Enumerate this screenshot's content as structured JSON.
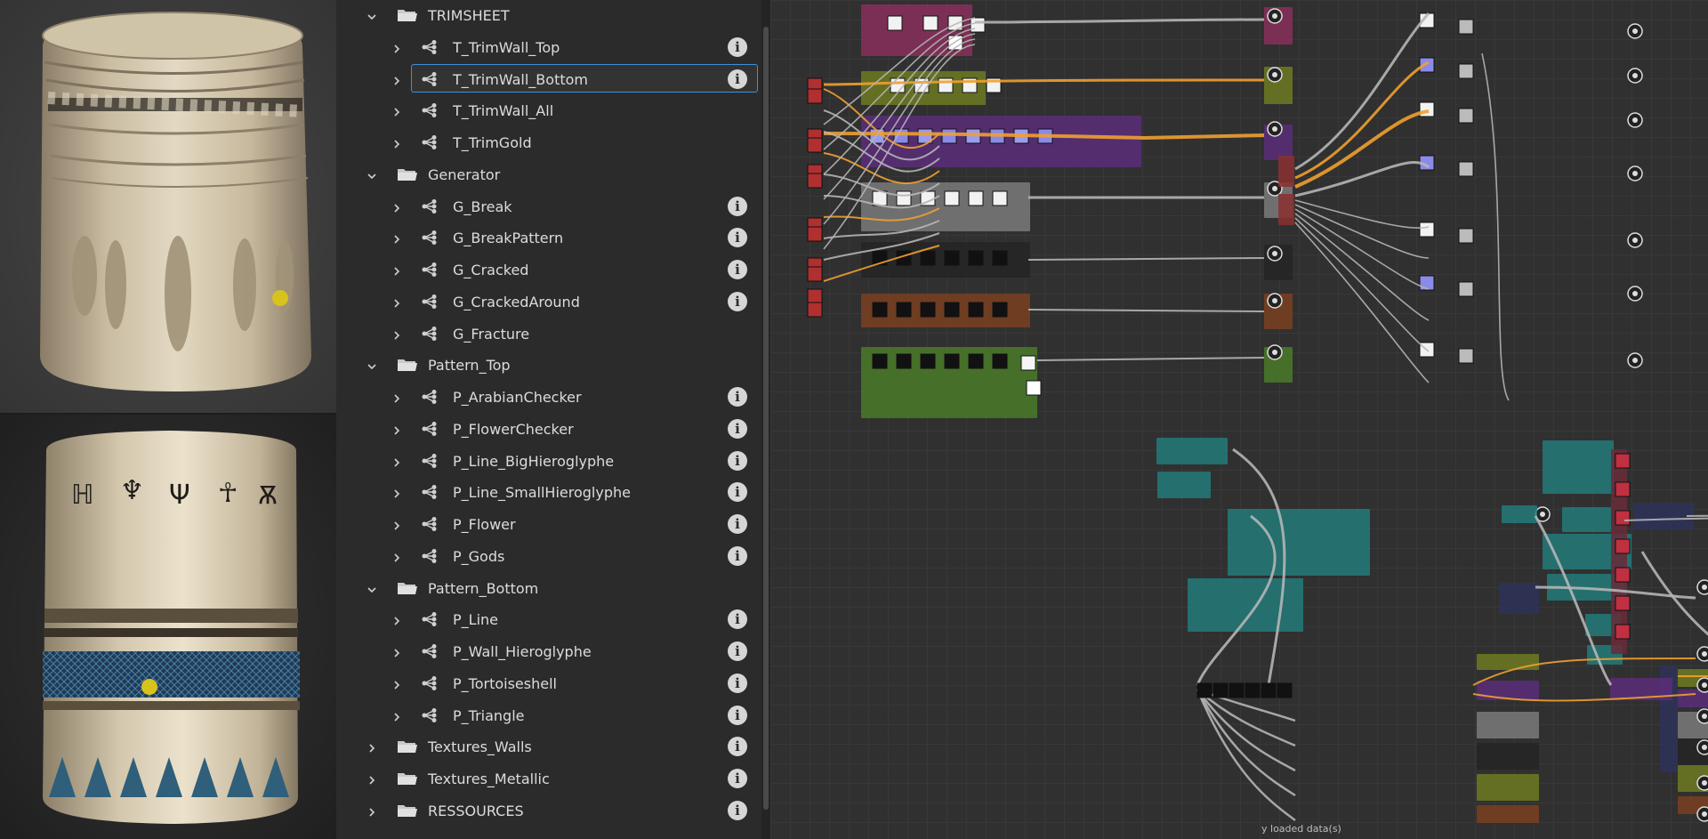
{
  "tree": {
    "items": [
      {
        "type": "folder",
        "label": "TRIMSHEET",
        "expanded": true,
        "info": false
      },
      {
        "type": "graph",
        "label": "T_TrimWall_Top",
        "info": true
      },
      {
        "type": "graph",
        "label": "T_TrimWall_Bottom",
        "info": true,
        "selected": true
      },
      {
        "type": "graph",
        "label": "T_TrimWall_All",
        "info": false
      },
      {
        "type": "graph",
        "label": "T_TrimGold",
        "info": false
      },
      {
        "type": "folder",
        "label": "Generator",
        "expanded": true,
        "info": false
      },
      {
        "type": "graph",
        "label": "G_Break",
        "info": true
      },
      {
        "type": "graph",
        "label": "G_BreakPattern",
        "info": true
      },
      {
        "type": "graph",
        "label": "G_Cracked",
        "info": true
      },
      {
        "type": "graph",
        "label": "G_CrackedAround",
        "info": true
      },
      {
        "type": "graph",
        "label": "G_Fracture",
        "info": false
      },
      {
        "type": "folder",
        "label": "Pattern_Top",
        "expanded": true,
        "info": false
      },
      {
        "type": "graph",
        "label": "P_ArabianChecker",
        "info": true
      },
      {
        "type": "graph",
        "label": "P_FlowerChecker",
        "info": true
      },
      {
        "type": "graph",
        "label": "P_Line_BigHieroglyphe",
        "info": true
      },
      {
        "type": "graph",
        "label": "P_Line_SmallHieroglyphe",
        "info": true
      },
      {
        "type": "graph",
        "label": "P_Flower",
        "info": true
      },
      {
        "type": "graph",
        "label": "P_Gods",
        "info": true
      },
      {
        "type": "folder",
        "label": "Pattern_Bottom",
        "expanded": true,
        "info": false
      },
      {
        "type": "graph",
        "label": "P_Line",
        "info": true
      },
      {
        "type": "graph",
        "label": "P_Wall_Hieroglyphe",
        "info": true
      },
      {
        "type": "graph",
        "label": "P_Tortoiseshell",
        "info": true
      },
      {
        "type": "graph",
        "label": "P_Triangle",
        "info": true
      },
      {
        "type": "folder",
        "label": "Textures_Walls",
        "expanded": false,
        "info": true
      },
      {
        "type": "folder",
        "label": "Textures_Metallic",
        "expanded": false,
        "info": true
      },
      {
        "type": "folder",
        "label": "RESSOURCES",
        "expanded": false,
        "info": true
      }
    ],
    "info_glyph": "i",
    "chevron_icon": "chevron-icon",
    "folder_icon": "folder-icon",
    "graph_icon": "graph-node-icon"
  },
  "status": {
    "text": "y loaded data(s)"
  },
  "colors": {
    "selection_border": "#3d8fe0",
    "wire_orange": "#f0a030",
    "wire_grey": "#b5b5b5",
    "frame_pink": "#8a2f5a",
    "frame_olive": "#6f7a22",
    "frame_purple": "#5a2d7a",
    "frame_grey": "#7a7a7a",
    "frame_black": "#252525",
    "frame_brown": "#7a4020",
    "frame_green": "#4a7a28",
    "frame_teal": "#237a7a",
    "frame_navy": "#2e3358"
  }
}
